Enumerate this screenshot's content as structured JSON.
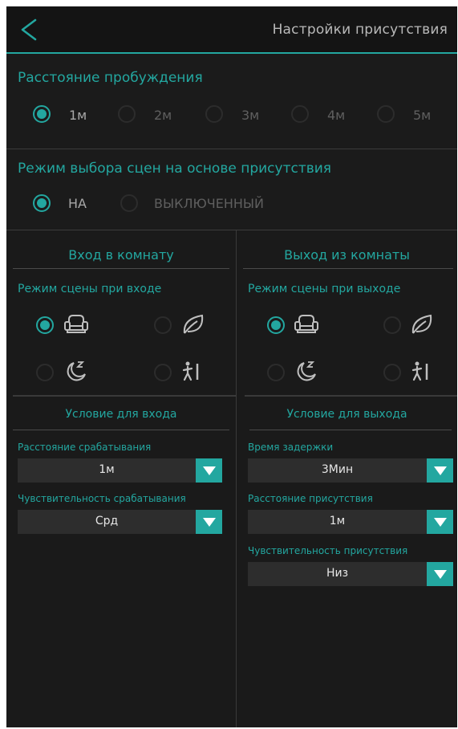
{
  "header": {
    "title": "Настройки присутствия"
  },
  "wake_distance": {
    "title": "Расстояние пробуждения",
    "options": [
      "1м",
      "2м",
      "3м",
      "4м",
      "5м"
    ],
    "selected": 0
  },
  "scene_mode": {
    "title": "Режим выбора сцен на основе присутствия",
    "options": [
      "НА",
      "ВЫКЛЮЧЕННЫЙ"
    ],
    "selected": 0
  },
  "enter": {
    "header": "Вход в комнату",
    "scene_title": "Режим сцены при входе",
    "scene_icons": [
      "sofa-icon",
      "leaf-icon",
      "sleep-moon-icon",
      "person-walk-icon"
    ],
    "selected_icon": 0,
    "condition_title": "Условие для входа",
    "fields": [
      {
        "label": "Расстояние срабатывания",
        "value": "1м"
      },
      {
        "label": "Чувствительность срабатывания",
        "value": "Срд"
      }
    ]
  },
  "exit": {
    "header": "Выход из комнаты",
    "scene_title": "Режим сцены при выходе",
    "scene_icons": [
      "sofa-icon",
      "leaf-icon",
      "sleep-moon-icon",
      "person-walk-icon"
    ],
    "selected_icon": 0,
    "condition_title": "Условие для выхода",
    "fields": [
      {
        "label": "Время задержки",
        "value": "3Мин"
      },
      {
        "label": "Расстояние присутствия",
        "value": "1м"
      },
      {
        "label": "Чувствительность присутствия",
        "value": "Низ"
      }
    ]
  },
  "colors": {
    "accent": "#23a7a0",
    "background": "#171717",
    "dropdown": "#2d2d2d"
  }
}
